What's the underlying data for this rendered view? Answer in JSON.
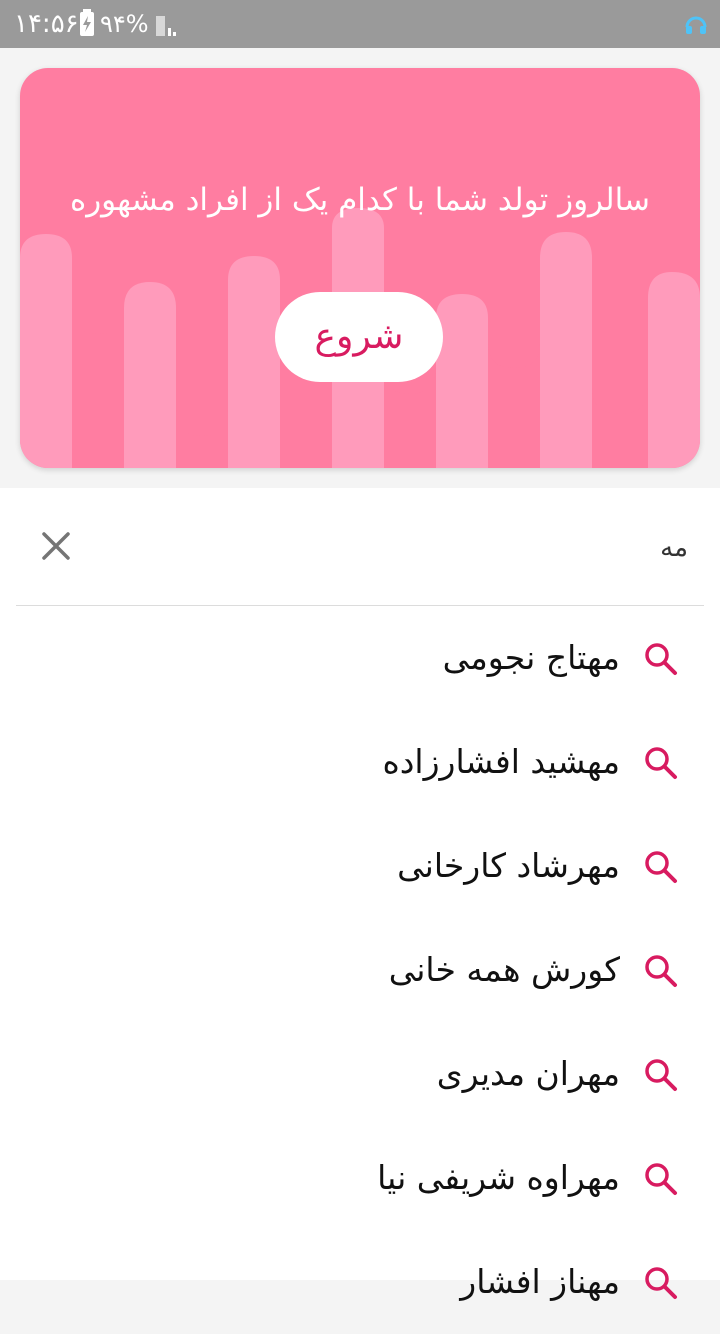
{
  "status_bar": {
    "time": "۱۴:۵۶",
    "battery_percent": "۹۴%",
    "battery_charging": true,
    "accent_color": "#4fc3f7"
  },
  "banner": {
    "title": "سالروز تولد شما با کدام یک از افراد مشهوره",
    "start_label": "شروع",
    "background_color": "#ff7da1",
    "drip_color": "#ff9bbb",
    "button_text_color": "#d81b60"
  },
  "search": {
    "query": "مه",
    "clear_icon": "close-icon"
  },
  "suggestions": {
    "icon": "search-icon",
    "icon_color": "#d81b60",
    "items": [
      {
        "label": "مهتاج نجومی"
      },
      {
        "label": "مهشید افشارزاده"
      },
      {
        "label": "مهرشاد کارخانی"
      },
      {
        "label": "کورش همه خانی"
      },
      {
        "label": "مهران مدیری"
      },
      {
        "label": "مهراوه شریفی نیا"
      },
      {
        "label": "مهناز افشار"
      }
    ]
  }
}
